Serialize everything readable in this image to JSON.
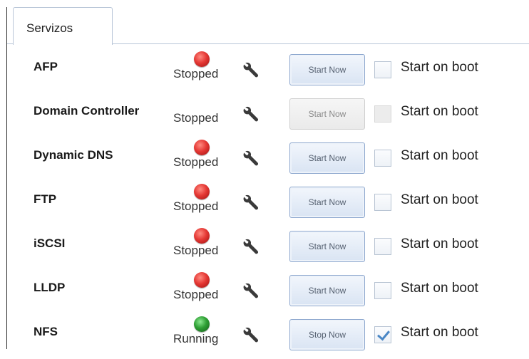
{
  "tab": {
    "label": "Servizos"
  },
  "services": [
    {
      "name": "AFP",
      "status": "Stopped",
      "led": "red",
      "button": "Start Now",
      "button_enabled": true,
      "boot_label": "Start on boot",
      "boot_checked": false,
      "boot_enabled": true
    },
    {
      "name": "Domain Controller",
      "status": "Stopped",
      "led": "none",
      "button": "Start Now",
      "button_enabled": false,
      "boot_label": "Start on boot",
      "boot_checked": false,
      "boot_enabled": false
    },
    {
      "name": "Dynamic DNS",
      "status": "Stopped",
      "led": "red",
      "button": "Start Now",
      "button_enabled": true,
      "boot_label": "Start on boot",
      "boot_checked": false,
      "boot_enabled": true
    },
    {
      "name": "FTP",
      "status": "Stopped",
      "led": "red",
      "button": "Start Now",
      "button_enabled": true,
      "boot_label": "Start on boot",
      "boot_checked": false,
      "boot_enabled": true
    },
    {
      "name": "iSCSI",
      "status": "Stopped",
      "led": "red",
      "button": "Start Now",
      "button_enabled": true,
      "boot_label": "Start on boot",
      "boot_checked": false,
      "boot_enabled": true
    },
    {
      "name": "LLDP",
      "status": "Stopped",
      "led": "red",
      "button": "Start Now",
      "button_enabled": true,
      "boot_label": "Start on boot",
      "boot_checked": false,
      "boot_enabled": true
    },
    {
      "name": "NFS",
      "status": "Running",
      "led": "green",
      "button": "Stop Now",
      "button_enabled": true,
      "boot_label": "Start on boot",
      "boot_checked": true,
      "boot_enabled": true
    }
  ],
  "icons": {
    "settings": "wrench-icon"
  },
  "colors": {
    "stopped": "#e53935",
    "running": "#2e9f34",
    "button_border": "#8fa9cf",
    "tab_border": "#b9c6d8"
  }
}
